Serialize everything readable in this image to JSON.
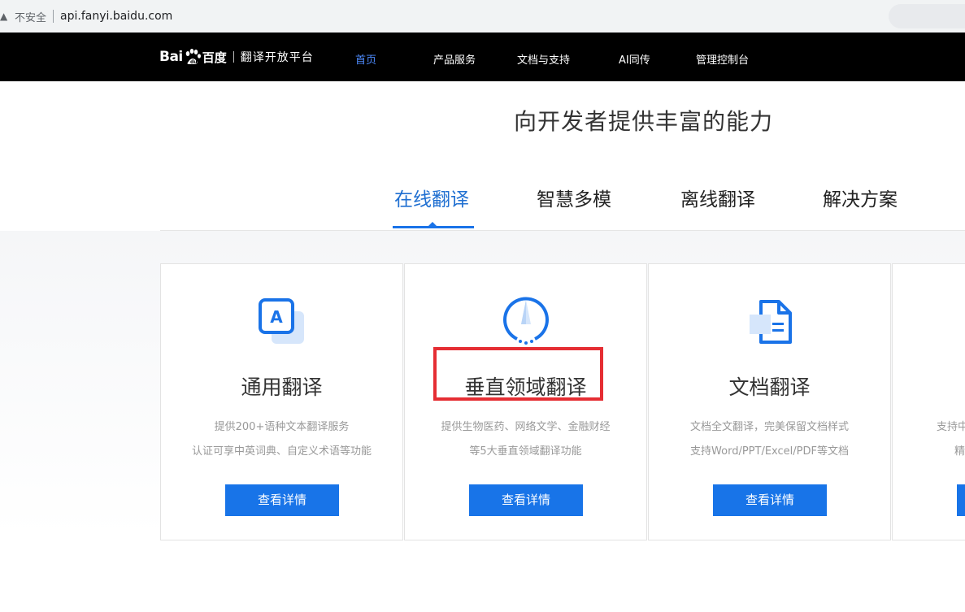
{
  "browser": {
    "security_label": "不安全",
    "url": "api.fanyi.baidu.com"
  },
  "nav": {
    "logo_text_en": "Bai",
    "logo_text_du": "du",
    "logo_text_cn": "百度",
    "logo_subtitle": "翻译开放平台",
    "items": [
      {
        "label": "首页",
        "active": true
      },
      {
        "label": "产品服务",
        "active": false
      },
      {
        "label": "文档与支持",
        "active": false
      },
      {
        "label": "AI同传",
        "active": false
      },
      {
        "label": "管理控制台",
        "active": false
      }
    ]
  },
  "hero": {
    "title": "向开发者提供丰富的能力"
  },
  "tabs": [
    {
      "label": "在线翻译",
      "active": true
    },
    {
      "label": "智慧多模",
      "active": false
    },
    {
      "label": "离线翻译",
      "active": false
    },
    {
      "label": "解决方案",
      "active": false
    }
  ],
  "cards": [
    {
      "icon": "text-translate-icon",
      "title": "通用翻译",
      "desc_line1": "提供200+语种文本翻译服务",
      "desc_line2": "认证可享中英词典、自定义术语等功能",
      "button": "查看详情"
    },
    {
      "icon": "domain-compass-icon",
      "title": "垂直领域翻译",
      "desc_line1": "提供生物医药、网络文学、金融财经",
      "desc_line2": "等5大垂直领域翻译功能",
      "button": "查看详情"
    },
    {
      "icon": "document-icon",
      "title": "文档翻译",
      "desc_line1": "文档全文翻译，完美保留文档样式",
      "desc_line2": "支持Word/PPT/Excel/PDF等文档",
      "button": "查看详情"
    },
    {
      "icon": "partial-card-icon",
      "title": "",
      "desc_line1": "支持中",
      "desc_line2": "精",
      "button": ""
    }
  ],
  "colors": {
    "accent": "#1874e8",
    "nav_bg": "#000000",
    "highlight_border": "#e52d33"
  }
}
